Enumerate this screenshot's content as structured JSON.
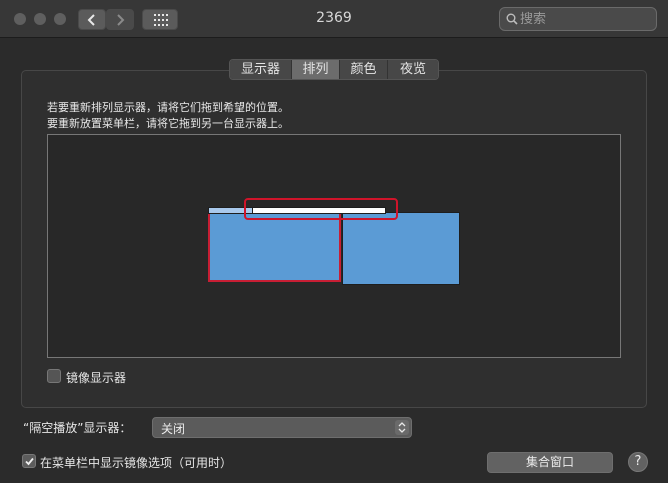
{
  "window": {
    "title": "2369"
  },
  "toolbar": {
    "back_icon": "chevron-left-icon",
    "forward_icon": "chevron-right-icon",
    "grid_icon": "show-all-grid-icon"
  },
  "search": {
    "placeholder": "搜索",
    "value": ""
  },
  "tabs": [
    {
      "label": "显示器",
      "active": false
    },
    {
      "label": "排列",
      "active": true
    },
    {
      "label": "颜色",
      "active": false
    },
    {
      "label": "夜览",
      "active": false
    }
  ],
  "arrangement": {
    "instruction_1": "若要重新排列显示器，请将它们拖到希望的位置。",
    "instruction_2": "要重新放置菜单栏，请将它拖到另一台显示器上。"
  },
  "mirror": {
    "label": "镜像显示器",
    "checked": false
  },
  "airplay": {
    "label": "“隔空播放”显示器：",
    "selected": "关闭"
  },
  "menubar_option": {
    "label": "在菜单栏中显示镜像选项（可用时）",
    "checked": true
  },
  "buttons": {
    "gather": "集合窗口",
    "help": "?"
  },
  "colors": {
    "display_fill": "#5b9bd5",
    "highlight": "#d0142a"
  }
}
